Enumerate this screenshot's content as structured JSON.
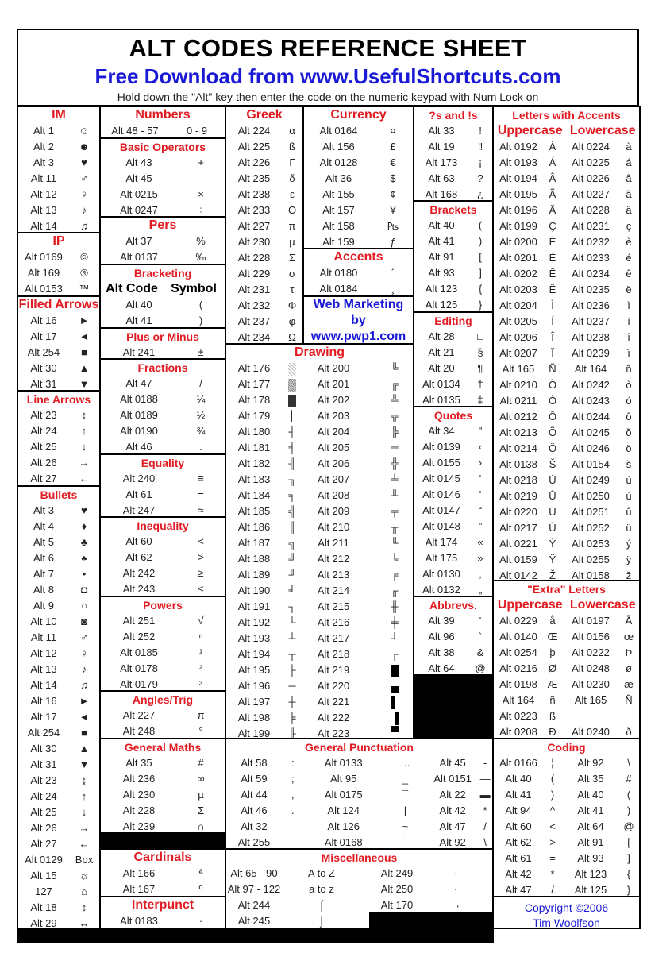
{
  "header": {
    "title": "ALT CODES REFERENCE SHEET",
    "subtitle": "Free Download from www.UsefulShortcuts.com",
    "instruction": "Hold down the \"Alt\" key then enter the code on the numeric keypad with Num Lock on"
  },
  "sections": {
    "im": {
      "title": "IM",
      "rows": [
        [
          "Alt 1",
          "☺"
        ],
        [
          "Alt 2",
          "☻"
        ],
        [
          "Alt 3",
          "♥"
        ],
        [
          "Alt 11",
          "♂"
        ],
        [
          "Alt 12",
          "♀"
        ],
        [
          "Alt 13",
          "♪"
        ],
        [
          "Alt 14",
          "♫"
        ]
      ]
    },
    "ip": {
      "title": "IP",
      "rows": [
        [
          "Alt 0169",
          "©"
        ],
        [
          "Alt 169",
          "®"
        ],
        [
          "Alt 0153",
          "™"
        ]
      ]
    },
    "filled_arrows": {
      "title": "Filled Arrows",
      "rows": [
        [
          "Alt 16",
          "►"
        ],
        [
          "Alt 17",
          "◄"
        ],
        [
          "Alt 254",
          "■"
        ],
        [
          "Alt 30",
          "▲"
        ],
        [
          "Alt 31",
          "▼"
        ]
      ]
    },
    "line_arrows": {
      "title": "Line Arrows",
      "rows": [
        [
          "Alt 23",
          "↨"
        ],
        [
          "Alt 24",
          "↑"
        ],
        [
          "Alt 25",
          "↓"
        ],
        [
          "Alt 26",
          "→"
        ],
        [
          "Alt 27",
          "←"
        ]
      ]
    },
    "bullets": {
      "title": "Bullets",
      "rows": [
        [
          "Alt 3",
          "♥"
        ],
        [
          "Alt 4",
          "♦"
        ],
        [
          "Alt 5",
          "♣"
        ],
        [
          "Alt 6",
          "♠"
        ],
        [
          "Alt 7",
          "•"
        ],
        [
          "Alt 8",
          "◘"
        ],
        [
          "Alt 9",
          "○"
        ],
        [
          "Alt 10",
          "◙"
        ],
        [
          "Alt 11",
          "♂"
        ],
        [
          "Alt 12",
          "♀"
        ],
        [
          "Alt 13",
          "♪"
        ],
        [
          "Alt 14",
          "♫"
        ],
        [
          "Alt 16",
          "►"
        ],
        [
          "Alt 17",
          "◄"
        ],
        [
          "Alt 254",
          "■"
        ],
        [
          "Alt 30",
          "▲"
        ],
        [
          "Alt 31",
          "▼"
        ],
        [
          "Alt 23",
          "↨"
        ],
        [
          "Alt 24",
          "↑"
        ],
        [
          "Alt 25",
          "↓"
        ],
        [
          "Alt 26",
          "→"
        ],
        [
          "Alt 27",
          "←"
        ],
        [
          "Alt 0129",
          "Box"
        ],
        [
          "Alt 15",
          "☼"
        ],
        [
          "127",
          "⌂"
        ],
        [
          "Alt 18",
          "↕"
        ],
        [
          "Alt 29",
          "↔"
        ]
      ]
    },
    "numbers": {
      "title": "Numbers",
      "rows": [
        [
          "Alt 48 - 57",
          "0 - 9"
        ]
      ]
    },
    "basic_operators": {
      "title": "Basic Operators",
      "rows": [
        [
          "Alt 43",
          "+"
        ],
        [
          "Alt 45",
          "-"
        ],
        [
          "Alt 0215",
          "×"
        ],
        [
          "Alt 0247",
          "÷"
        ]
      ]
    },
    "pers": {
      "title": "Pers",
      "rows": [
        [
          "Alt 37",
          "%"
        ],
        [
          "Alt 0137",
          "‰"
        ]
      ]
    },
    "bracketing": {
      "title": "Bracketing",
      "col_headers": [
        "Alt Code",
        "Symbol"
      ],
      "rows": [
        [
          "Alt 40",
          "("
        ],
        [
          "Alt 41",
          ")"
        ]
      ]
    },
    "plus_minus": {
      "title": "Plus or Minus",
      "rows": [
        [
          "Alt 241",
          "±"
        ]
      ]
    },
    "fractions": {
      "title": "Fractions",
      "rows": [
        [
          "Alt 47",
          "/"
        ],
        [
          "Alt 0188",
          "¼"
        ],
        [
          "Alt 0189",
          "½"
        ],
        [
          "Alt 0190",
          "¾"
        ],
        [
          "Alt 46",
          "."
        ]
      ]
    },
    "equality": {
      "title": "Equality",
      "rows": [
        [
          "Alt 240",
          "≡"
        ],
        [
          "Alt 61",
          "="
        ],
        [
          "Alt 247",
          "≈"
        ]
      ]
    },
    "inequality": {
      "title": "Inequality",
      "rows": [
        [
          "Alt 60",
          "<"
        ],
        [
          "Alt 62",
          ">"
        ],
        [
          "Alt 242",
          "≥"
        ],
        [
          "Alt 243",
          "≤"
        ]
      ]
    },
    "powers": {
      "title": "Powers",
      "rows": [
        [
          "Alt 251",
          "√"
        ],
        [
          "Alt 252",
          "ⁿ"
        ],
        [
          "Alt 0185",
          "¹"
        ],
        [
          "Alt 0178",
          "²"
        ],
        [
          "Alt 0179",
          "³"
        ]
      ]
    },
    "angles": {
      "title": "Angles/Trig",
      "rows": [
        [
          "Alt 227",
          "π"
        ],
        [
          "Alt 248",
          "°"
        ]
      ]
    },
    "general_maths": {
      "title": "General Maths",
      "rows": [
        [
          "Alt 35",
          "#"
        ],
        [
          "Alt 236",
          "∞"
        ],
        [
          "Alt 230",
          "µ"
        ],
        [
          "Alt 228",
          "Σ"
        ],
        [
          "Alt 239",
          "∩"
        ]
      ]
    },
    "cardinals": {
      "title": "Cardinals",
      "rows": [
        [
          "Alt 166",
          "ª"
        ],
        [
          "Alt 167",
          "º"
        ]
      ]
    },
    "interpunct": {
      "title": "Interpunct",
      "rows": [
        [
          "Alt 0183",
          "·"
        ]
      ]
    },
    "greek": {
      "title": "Greek",
      "rows": [
        [
          "Alt 224",
          "α"
        ],
        [
          "Alt 225",
          "ß"
        ],
        [
          "Alt 226",
          "Γ"
        ],
        [
          "Alt 235",
          "δ"
        ],
        [
          "Alt 238",
          "ε"
        ],
        [
          "Alt 233",
          "Θ"
        ],
        [
          "Alt 227",
          "π"
        ],
        [
          "Alt 230",
          "µ"
        ],
        [
          "Alt 228",
          "Σ"
        ],
        [
          "Alt 229",
          "σ"
        ],
        [
          "Alt 231",
          "τ"
        ],
        [
          "Alt 232",
          "Φ"
        ],
        [
          "Alt 237",
          "φ"
        ],
        [
          "Alt 234",
          "Ω"
        ]
      ]
    },
    "currency": {
      "title": "Currency",
      "rows": [
        [
          "Alt 0164",
          "¤"
        ],
        [
          "Alt 156",
          "£"
        ],
        [
          "Alt 0128",
          "€"
        ],
        [
          "Alt 36",
          "$"
        ],
        [
          "Alt 155",
          "¢"
        ],
        [
          "Alt 157",
          "¥"
        ],
        [
          "Alt 158",
          "₧"
        ],
        [
          "Alt 159",
          "ƒ"
        ]
      ]
    },
    "accents": {
      "title": "Accents",
      "rows": [
        [
          "Alt 0180",
          "´"
        ],
        [
          "Alt 0184",
          "¸"
        ]
      ]
    },
    "web_marketing": {
      "lines": [
        "Web Marketing",
        "by",
        "www.pwp1.com"
      ]
    },
    "drawing": {
      "title": "Drawing",
      "left": [
        [
          "Alt 176",
          "░"
        ],
        [
          "Alt 177",
          "▒"
        ],
        [
          "Alt 178",
          "▓"
        ],
        [
          "Alt 179",
          "│"
        ],
        [
          "Alt 180",
          "┤"
        ],
        [
          "Alt 181",
          "╡"
        ],
        [
          "Alt 182",
          "╢"
        ],
        [
          "Alt 183",
          "╖"
        ],
        [
          "Alt 184",
          "╕"
        ],
        [
          "Alt 185",
          "╣"
        ],
        [
          "Alt 186",
          "║"
        ],
        [
          "Alt 187",
          "╗"
        ],
        [
          "Alt 188",
          "╝"
        ],
        [
          "Alt 189",
          "╜"
        ],
        [
          "Alt 190",
          "╛"
        ],
        [
          "Alt 191",
          "┐"
        ],
        [
          "Alt 192",
          "└"
        ],
        [
          "Alt 193",
          "┴"
        ],
        [
          "Alt 194",
          "┬"
        ],
        [
          "Alt 195",
          "├"
        ],
        [
          "Alt 196",
          "─"
        ],
        [
          "Alt 197",
          "┼"
        ],
        [
          "Alt 198",
          "╞"
        ],
        [
          "Alt 199",
          "╟"
        ]
      ],
      "right": [
        [
          "Alt 200",
          "╚"
        ],
        [
          "Alt 201",
          "╔"
        ],
        [
          "Alt 202",
          "╩"
        ],
        [
          "Alt 203",
          "╦"
        ],
        [
          "Alt 204",
          "╠"
        ],
        [
          "Alt 205",
          "═"
        ],
        [
          "Alt 206",
          "╬"
        ],
        [
          "Alt 207",
          "╧"
        ],
        [
          "Alt 208",
          "╨"
        ],
        [
          "Alt 209",
          "╤"
        ],
        [
          "Alt 210",
          "╥"
        ],
        [
          "Alt 211",
          "╙"
        ],
        [
          "Alt 212",
          "╘"
        ],
        [
          "Alt 213",
          "╒"
        ],
        [
          "Alt 214",
          "╓"
        ],
        [
          "Alt 215",
          "╫"
        ],
        [
          "Alt 216",
          "╪"
        ],
        [
          "Alt 217",
          "┘"
        ],
        [
          "Alt 218",
          "┌"
        ],
        [
          "Alt 219",
          "█"
        ],
        [
          "Alt 220",
          "▄"
        ],
        [
          "Alt 221",
          "▌"
        ],
        [
          "Alt 222",
          "▐"
        ],
        [
          "Alt 223",
          "▀"
        ]
      ]
    },
    "general_punctuation": {
      "title": "General Punctuation",
      "rows": [
        [
          "Alt 58",
          ":",
          "Alt 0133",
          "…",
          "Alt 45",
          "-"
        ],
        [
          "Alt 59",
          ";",
          "Alt 95",
          "_",
          "Alt 0151",
          "—"
        ],
        [
          "Alt 44",
          ",",
          "Alt 0175",
          "¯",
          "Alt 22",
          "▬"
        ],
        [
          "Alt 46",
          ".",
          "Alt 124",
          "|",
          "Alt 42",
          "*"
        ],
        [
          "Alt 32",
          " ",
          "Alt 126",
          "~",
          "Alt 47",
          "/"
        ],
        [
          "Alt 255",
          " ",
          "Alt 0168",
          "¨",
          "Alt 92",
          "\\"
        ]
      ]
    },
    "miscellaneous": {
      "title": "Miscellaneous",
      "rows": [
        [
          "Alt 65 - 90",
          "A to Z",
          "Alt 249",
          "∙"
        ],
        [
          "Alt 97 - 122",
          "a to z",
          "Alt 250",
          "·"
        ],
        [
          "Alt 244",
          "⌠",
          "Alt 170",
          "¬"
        ],
        [
          "Alt 245",
          "⌡",
          "",
          ""
        ]
      ]
    },
    "questions": {
      "title": "?s and !s",
      "rows": [
        [
          "Alt 33",
          "!"
        ],
        [
          "Alt 19",
          "‼"
        ],
        [
          "Alt 173",
          "¡"
        ],
        [
          "Alt 63",
          "?"
        ],
        [
          "Alt 168",
          "¿"
        ]
      ]
    },
    "brackets": {
      "title": "Brackets",
      "rows": [
        [
          "Alt 40",
          "("
        ],
        [
          "Alt 41",
          ")"
        ],
        [
          "Alt 91",
          "["
        ],
        [
          "Alt 93",
          "]"
        ],
        [
          "Alt 123",
          "{"
        ],
        [
          "Alt 125",
          "}"
        ]
      ]
    },
    "editing": {
      "title": "Editing",
      "rows": [
        [
          "Alt 28",
          "∟"
        ],
        [
          "Alt 21",
          "§"
        ],
        [
          "Alt 20",
          "¶"
        ],
        [
          "Alt 0134",
          "†"
        ],
        [
          "Alt 0135",
          "‡"
        ]
      ]
    },
    "quotes": {
      "title": "Quotes",
      "rows": [
        [
          "Alt 34",
          "\""
        ],
        [
          "Alt 0139",
          "‹"
        ],
        [
          "Alt 0155",
          "›"
        ],
        [
          "Alt 0145",
          "‘"
        ],
        [
          "Alt 0146",
          "’"
        ],
        [
          "Alt 0147",
          "“"
        ],
        [
          "Alt 0148",
          "”"
        ],
        [
          "Alt 174",
          "«"
        ],
        [
          "Alt 175",
          "»"
        ],
        [
          "Alt 0130",
          "‚"
        ],
        [
          "Alt 0132",
          "„"
        ]
      ]
    },
    "abbrevs": {
      "title": "Abbrevs.",
      "rows": [
        [
          "Alt 39",
          "'"
        ],
        [
          "Alt 96",
          "`"
        ],
        [
          "Alt 38",
          "&"
        ],
        [
          "Alt 64",
          "@"
        ]
      ]
    },
    "letters_accents": {
      "title": "Letters with Accents",
      "col_headers": [
        "Uppercase",
        "Lowercase"
      ],
      "rows": [
        [
          "Alt 0192",
          "À",
          "Alt 0224",
          "à"
        ],
        [
          "Alt 0193",
          "Á",
          "Alt 0225",
          "á"
        ],
        [
          "Alt 0194",
          "Â",
          "Alt 0226",
          "â"
        ],
        [
          "Alt 0195",
          "Ã",
          "Alt 0227",
          "ã"
        ],
        [
          "Alt 0196",
          "Ä",
          "Alt 0228",
          "ä"
        ],
        [
          "Alt 0199",
          "Ç",
          "Alt 0231",
          "ç"
        ],
        [
          "Alt 0200",
          "È",
          "Alt 0232",
          "è"
        ],
        [
          "Alt 0201",
          "É",
          "Alt 0233",
          "é"
        ],
        [
          "Alt 0202",
          "Ê",
          "Alt 0234",
          "ê"
        ],
        [
          "Alt 0203",
          "Ë",
          "Alt 0235",
          "ë"
        ],
        [
          "Alt 0204",
          "Ì",
          "Alt 0236",
          "ì"
        ],
        [
          "Alt 0205",
          "Í",
          "Alt 0237",
          "í"
        ],
        [
          "Alt 0206",
          "Î",
          "Alt 0238",
          "î"
        ],
        [
          "Alt 0207",
          "Ï",
          "Alt 0239",
          "ï"
        ],
        [
          "Alt 165",
          "Ñ",
          "Alt 164",
          "ñ"
        ],
        [
          "Alt 0210",
          "Ò",
          "Alt 0242",
          "ò"
        ],
        [
          "Alt 0211",
          "Ó",
          "Alt 0243",
          "ó"
        ],
        [
          "Alt 0212",
          "Ô",
          "Alt 0244",
          "ô"
        ],
        [
          "Alt 0213",
          "Õ",
          "Alt 0245",
          "õ"
        ],
        [
          "Alt 0214",
          "Ö",
          "Alt 0246",
          "ö"
        ],
        [
          "Alt 0138",
          "Š",
          "Alt 0154",
          "š"
        ],
        [
          "Alt 0218",
          "Ú",
          "Alt 0249",
          "ù"
        ],
        [
          "Alt 0219",
          "Û",
          "Alt 0250",
          "ú"
        ],
        [
          "Alt 0220",
          "Ü",
          "Alt 0251",
          "û"
        ],
        [
          "Alt 0217",
          "Ù",
          "Alt 0252",
          "ü"
        ],
        [
          "Alt 0221",
          "Ý",
          "Alt 0253",
          "ý"
        ],
        [
          "Alt 0159",
          "Ÿ",
          "Alt 0255",
          "ÿ"
        ],
        [
          "Alt 0142",
          "Ž",
          "Alt 0158",
          "ž"
        ]
      ]
    },
    "extra_letters": {
      "title": "\"Extra\" Letters",
      "col_headers": [
        "Uppercase",
        "Lowercase"
      ],
      "rows": [
        [
          "Alt 0229",
          "å",
          "Alt 0197",
          "Å"
        ],
        [
          "Alt 0140",
          "Œ",
          "Alt 0156",
          "œ"
        ],
        [
          "Alt 0254",
          "þ",
          "Alt 0222",
          "Þ"
        ],
        [
          "Alt 0216",
          "Ø",
          "Alt 0248",
          "ø"
        ],
        [
          "Alt 0198",
          "Æ",
          "Alt 0230",
          "æ"
        ],
        [
          "Alt 164",
          "ñ",
          "Alt 165",
          "Ñ"
        ],
        [
          "Alt 0223",
          "ß",
          "",
          ""
        ],
        [
          "Alt 0208",
          "Ð",
          "Alt 0240",
          "ð"
        ]
      ]
    },
    "coding": {
      "title": "Coding",
      "rows": [
        [
          "Alt 0166",
          "¦",
          "Alt 92",
          "\\"
        ],
        [
          "Alt 40",
          "(",
          "Alt 35",
          "#"
        ],
        [
          "Alt 41",
          ")",
          "Alt 40",
          "("
        ],
        [
          "Alt 94",
          "^",
          "Alt 41",
          ")"
        ],
        [
          "Alt 60",
          "<",
          "Alt 64",
          "@"
        ],
        [
          "Alt 62",
          ">",
          "Alt 91",
          "["
        ],
        [
          "Alt 61",
          "=",
          "Alt 93",
          "]"
        ],
        [
          "Alt 42",
          "*",
          "Alt 123",
          "{"
        ],
        [
          "Alt 47",
          "/",
          "Alt 125",
          "}"
        ]
      ]
    },
    "copyright": {
      "lines": [
        "Copyright ©2006",
        "Tim Woolfson"
      ]
    }
  }
}
